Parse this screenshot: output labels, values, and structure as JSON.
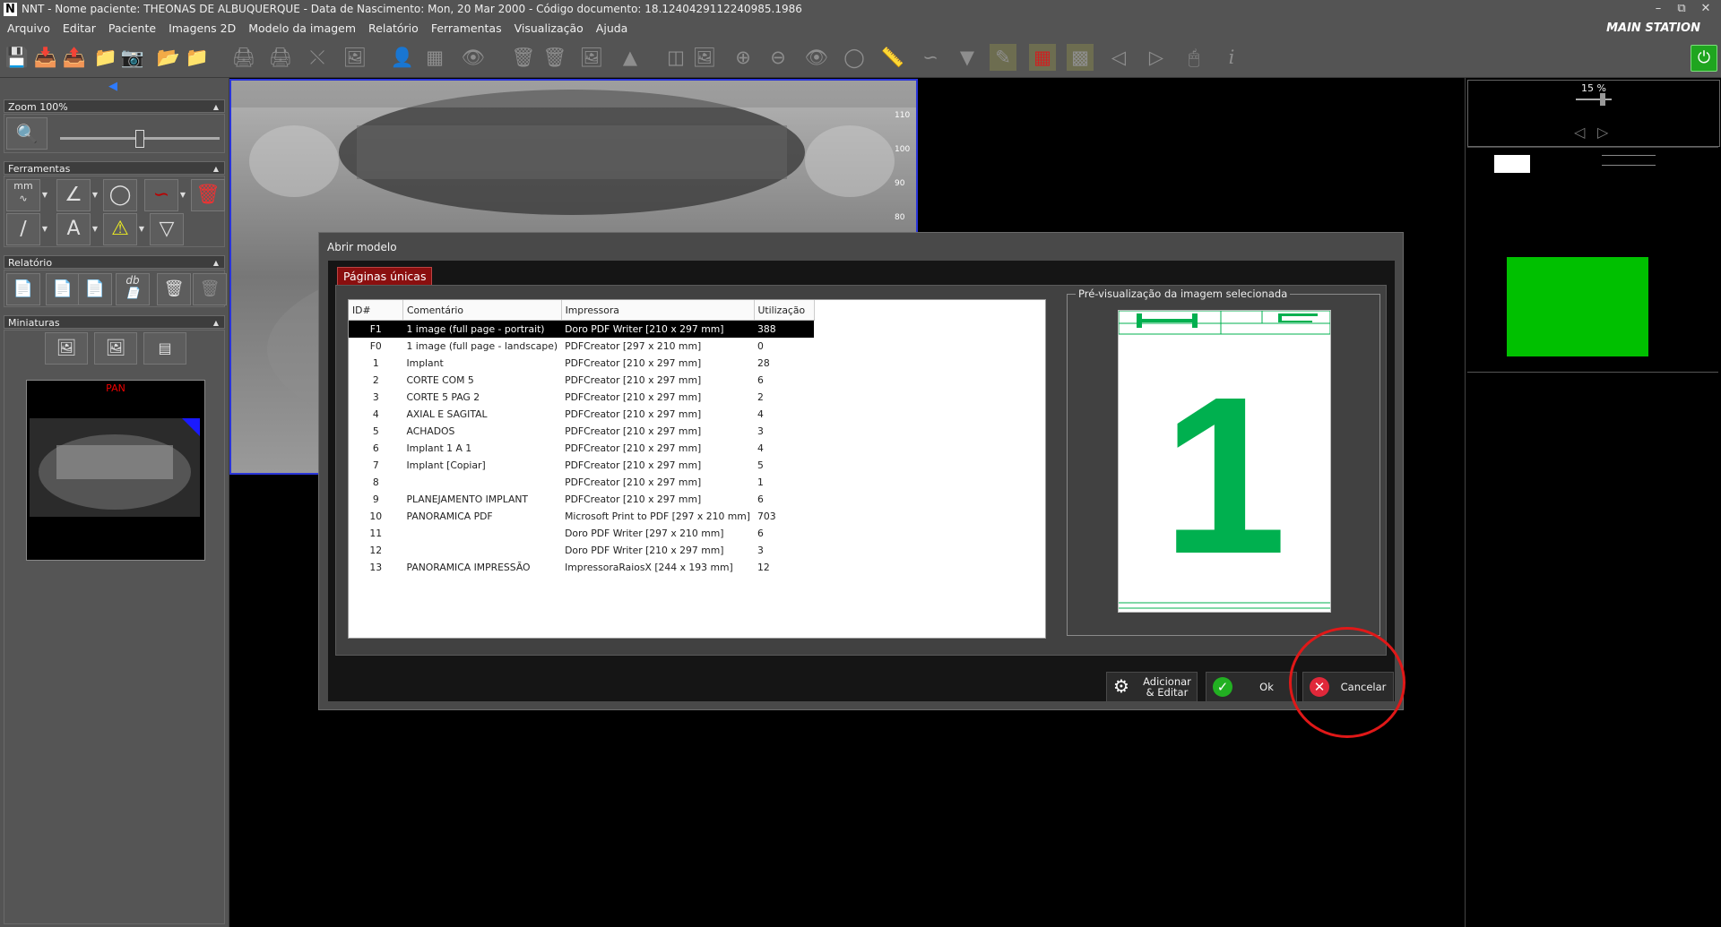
{
  "window": {
    "logo": "N",
    "title": "NNT - Nome paciente: THEONAS DE ALBUQUERQUE - Data de Nascimento: Mon, 20 Mar 2000 - Código documento: 18.1240429112240985.1986",
    "station": "MAIN STATION"
  },
  "menu": [
    "Arquivo",
    "Editar",
    "Paciente",
    "Imagens 2D",
    "Modelo da imagem",
    "Relatório",
    "Ferramentas",
    "Visualização",
    "Ajuda"
  ],
  "left_panel": {
    "zoom_header": "Zoom 100%",
    "zoom_level": 0.5,
    "tools_header": "Ferramentas",
    "tool_mm_label": "mm",
    "tool_text_label": "A",
    "report_header": "Relatório",
    "report_db_label": "db",
    "thumbs_header": "Miniaturas",
    "thumb_label": "PAN"
  },
  "xray": {
    "scale_labels": [
      "110",
      "100",
      "90",
      "80"
    ]
  },
  "right_panel": {
    "zoom_percent": "15 %"
  },
  "dialog": {
    "title": "Abrir modelo",
    "tab": "Páginas únicas",
    "columns": [
      "ID#",
      "Comentário",
      "Impressora",
      "Utilização"
    ],
    "rows": [
      {
        "id": "F1",
        "comment": "1 image (full page - portrait)",
        "printer": "Doro PDF Writer [210 x 297 mm]",
        "usage": "388",
        "selected": true
      },
      {
        "id": "F0",
        "comment": "1 image (full page - landscape)",
        "printer": "PDFCreator [297 x 210 mm]",
        "usage": "0"
      },
      {
        "id": "1",
        "comment": "Implant",
        "printer": "PDFCreator [210 x 297 mm]",
        "usage": "28"
      },
      {
        "id": "2",
        "comment": "CORTE COM 5",
        "printer": "PDFCreator [210 x 297 mm]",
        "usage": "6"
      },
      {
        "id": "3",
        "comment": "CORTE 5 PAG 2",
        "printer": "PDFCreator [210 x 297 mm]",
        "usage": "2"
      },
      {
        "id": "4",
        "comment": "AXIAL E SAGITAL",
        "printer": "PDFCreator [210 x 297 mm]",
        "usage": "4"
      },
      {
        "id": "5",
        "comment": "ACHADOS",
        "printer": "PDFCreator [210 x 297 mm]",
        "usage": "3"
      },
      {
        "id": "6",
        "comment": "Implant 1 A 1",
        "printer": "PDFCreator [210 x 297 mm]",
        "usage": "4"
      },
      {
        "id": "7",
        "comment": "Implant [Copiar]",
        "printer": "PDFCreator [210 x 297 mm]",
        "usage": "5"
      },
      {
        "id": "8",
        "comment": "",
        "printer": "PDFCreator [210 x 297 mm]",
        "usage": "1"
      },
      {
        "id": "9",
        "comment": "PLANEJAMENTO IMPLANT",
        "printer": "PDFCreator [210 x 297 mm]",
        "usage": "6"
      },
      {
        "id": "10",
        "comment": "PANORAMICA PDF",
        "printer": "Microsoft Print to PDF [297 x 210 mm]",
        "usage": "703"
      },
      {
        "id": "11",
        "comment": "",
        "printer": "Doro PDF Writer [297 x 210 mm]",
        "usage": "6"
      },
      {
        "id": "12",
        "comment": "",
        "printer": "Doro PDF Writer [210 x 297 mm]",
        "usage": "3"
      },
      {
        "id": "13",
        "comment": "PANORAMICA IMPRESSÃO",
        "printer": "ImpressoraRaiosX [244 x 193 mm]",
        "usage": "12"
      }
    ],
    "preview_label": "Pré-visualização da imagem selecionada",
    "preview_number": "1",
    "buttons": {
      "add_edit": "Adicionar & Editar",
      "ok": "Ok",
      "cancel": "Cancelar"
    }
  },
  "colors": {
    "accent_green": "#00b04f",
    "tab_red": "#8a0f0f",
    "highlight_circle": "#e01818",
    "frame_blue": "#2a35d8"
  }
}
